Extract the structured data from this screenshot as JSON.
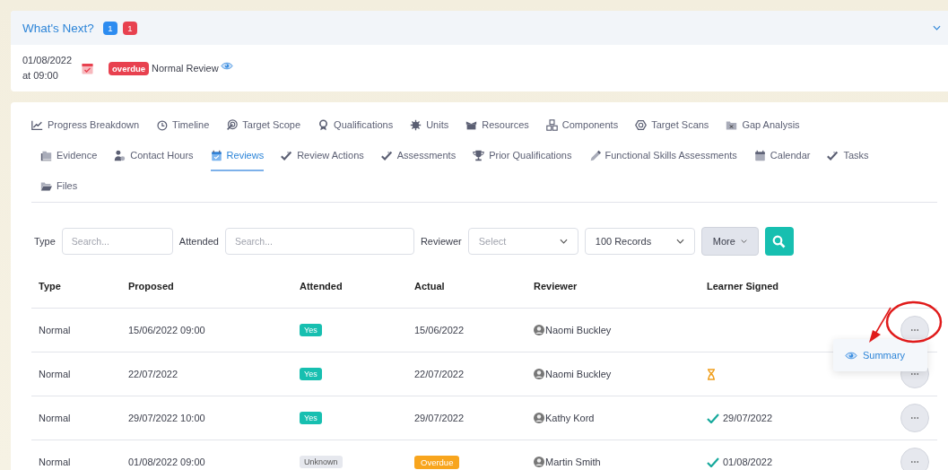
{
  "whats_next": {
    "title": "What's Next?",
    "badges": [
      {
        "text": "1",
        "color": "#2d8cf0"
      },
      {
        "text": "1",
        "color": "#e8414f"
      }
    ],
    "items": [
      {
        "date": "01/08/2022",
        "time": "at 09:00",
        "status": "overdue",
        "label": "Normal Review"
      }
    ]
  },
  "tab_rows": [
    [
      {
        "label": "Progress Breakdown",
        "selected": false
      },
      {
        "label": "Timeline",
        "selected": false
      },
      {
        "label": "Target Scope",
        "selected": false
      },
      {
        "label": "Qualifications",
        "selected": false
      },
      {
        "label": "Units",
        "selected": false
      },
      {
        "label": "Resources",
        "selected": false
      },
      {
        "label": "Components",
        "selected": false
      },
      {
        "label": "Target Scans",
        "selected": false
      },
      {
        "label": "Gap Analysis",
        "selected": false
      }
    ],
    [
      {
        "label": "Evidence",
        "selected": false
      },
      {
        "label": "Contact Hours",
        "selected": false
      },
      {
        "label": "Reviews",
        "selected": true
      },
      {
        "label": "Review Actions",
        "selected": false
      },
      {
        "label": "Assessments",
        "selected": false
      },
      {
        "label": "Prior Qualifications",
        "selected": false
      },
      {
        "label": "Functional Skills Assessments",
        "selected": false
      },
      {
        "label": "Calendar",
        "selected": false
      },
      {
        "label": "Tasks",
        "selected": false
      }
    ],
    [
      {
        "label": "Files",
        "selected": false
      }
    ]
  ],
  "filters": {
    "type_label": "Type",
    "type_placeholder": "Search...",
    "attended_label": "Attended",
    "attended_placeholder": "Search...",
    "reviewer_label": "Reviewer",
    "reviewer_placeholder": "Select",
    "records": "100 Records",
    "more": "More"
  },
  "table": {
    "columns": [
      "Type",
      "Proposed",
      "Attended",
      "Actual",
      "Reviewer",
      "Learner Signed"
    ],
    "rows": [
      {
        "type": "Normal",
        "proposed": "15/06/2022 09:00",
        "attended": {
          "text": "Yes",
          "kind": "yes"
        },
        "actual": {
          "text": "15/06/2022",
          "kind": "date"
        },
        "reviewer": "Naomi Buckley",
        "learner_signed": {
          "kind": "none"
        }
      },
      {
        "type": "Normal",
        "proposed": "22/07/2022",
        "attended": {
          "text": "Yes",
          "kind": "yes"
        },
        "actual": {
          "text": "22/07/2022",
          "kind": "date"
        },
        "reviewer": "Naomi Buckley",
        "learner_signed": {
          "kind": "pending"
        }
      },
      {
        "type": "Normal",
        "proposed": "29/07/2022 10:00",
        "attended": {
          "text": "Yes",
          "kind": "yes"
        },
        "actual": {
          "text": "29/07/2022",
          "kind": "date"
        },
        "reviewer": "Kathy Kord",
        "learner_signed": {
          "kind": "signed",
          "date": "29/07/2022"
        }
      },
      {
        "type": "Normal",
        "proposed": "01/08/2022 09:00",
        "attended": {
          "text": "Unknown",
          "kind": "unknown"
        },
        "actual": {
          "text": "Overdue",
          "kind": "overdue"
        },
        "reviewer": "Martin Smith",
        "learner_signed": {
          "kind": "signed",
          "date": "01/08/2022"
        }
      }
    ]
  },
  "row_menu": {
    "items": [
      {
        "label": "Summary"
      }
    ]
  }
}
